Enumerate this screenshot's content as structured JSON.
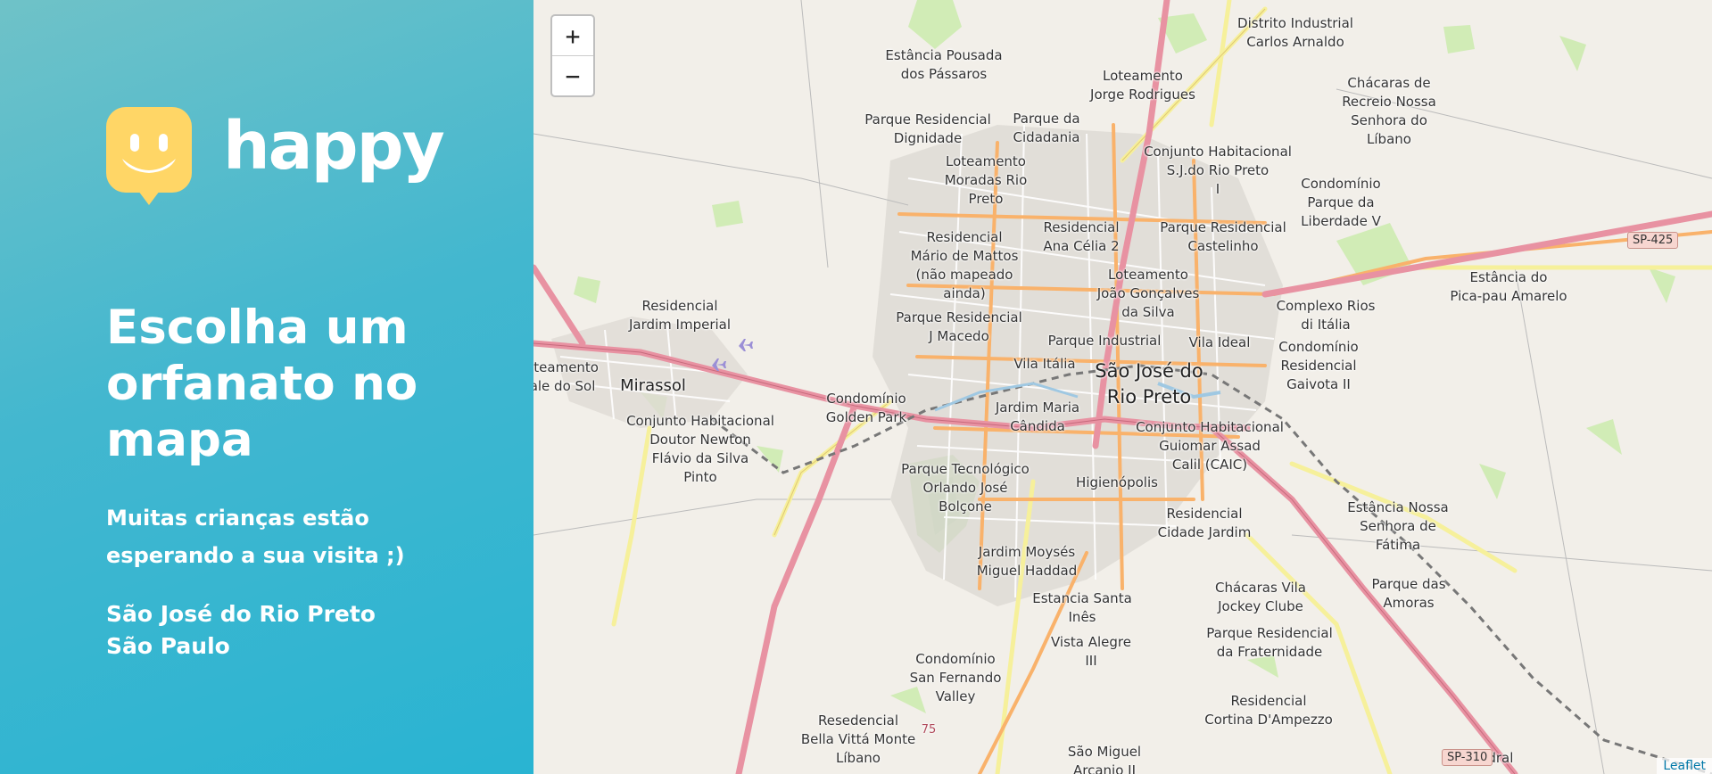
{
  "brand": {
    "logo_text": "happy",
    "logo_color": "#ffd666",
    "sidebar_gradient": [
      "#6fc2c8",
      "#29b4d2"
    ]
  },
  "hero": {
    "title": "Escolha um orfanato no mapa",
    "subtitle": "Muitas crianças estão esperando a sua visita ;)"
  },
  "location": {
    "city": "São José do Rio Preto",
    "state": "São Paulo"
  },
  "map": {
    "zoom_in_label": "+",
    "zoom_out_label": "−",
    "attribution": "Leaflet",
    "labels": {
      "l1": "Distrito Industrial\nCarlos Arnaldo",
      "l2": "Estância Pousada\ndos Pássaros",
      "l3": "Loteamento\nJorge Rodrigues",
      "l4": "Chácaras de\nRecreio Nossa\nSenhora do\nLíbano",
      "l5": "Parque Residencial\nDignidade",
      "l6": "Parque da\nCidadania",
      "l7": "Conjunto Habitacional\nS.J.do Rio Preto\nI",
      "l8": "Loteamento\nMoradas Rio\nPreto",
      "l9": "Condomínio\nParque da\nLiberdade V",
      "l10": "Residencial\nAna Célia 2",
      "l11": "Parque Residencial\nCastelinho",
      "l12": "Residencial\nMário de Mattos\n(não mapeado\nainda)",
      "l13": "Loteamento\nJoão Gonçalves\nda Silva",
      "l14": "Estância do\nPica-pau Amarelo",
      "l15": "Residencial\nJardim Imperial",
      "l16": "Parque Residencial\nJ Macedo",
      "l17": "Complexo Rios\ndi Itália",
      "l18": "Parque Industrial",
      "l19": "Condomínio\nResidencial\nGaivota II",
      "l20": "Vila Ideal",
      "l21": "Vila Itália",
      "l22": "Loteamento\nVale do Sol",
      "l23": "Mirassol",
      "l24": "São José do\nRio Preto",
      "l25": "Condomínio\nGolden Park",
      "l26": "Jardim Maria\nCândida",
      "l27": "Conjunto Habitacional\nDoutor Newton\nFlávio da Silva\nPinto",
      "l28": "Conjunto Habitacional\nGuiomar Assad\nCalil (CAIC)",
      "l29": "Parque Tecnológico\nOrlando José\nBolçone",
      "l30": "Higienópolis",
      "l31": "Estância Nossa\nSenhora de\nFátima",
      "l32": "Residencial\nCidade Jardim",
      "l33": "Jardim Moysés\nMiguel Haddad",
      "l34": "Chácaras Vila\nJockey Clube",
      "l35": "Parque das\nAmoras",
      "l36": "Estancia Santa\nInês",
      "l37": "Parque Residencial\nda Fraternidade",
      "l38": "Vista Alegre\nIII",
      "l39": "Condomínio\nSan Fernando\nValley",
      "l40": "Residencial\nCortina D'Ampezzo",
      "l41": "Resedencial\nBella Vittá Monte\nLíbano",
      "l42": "São Miguel\nArcanjo II",
      "l43": "Cedral",
      "l44": "75"
    },
    "shields": {
      "s1": "SP-425",
      "s2": "SP-310"
    }
  }
}
